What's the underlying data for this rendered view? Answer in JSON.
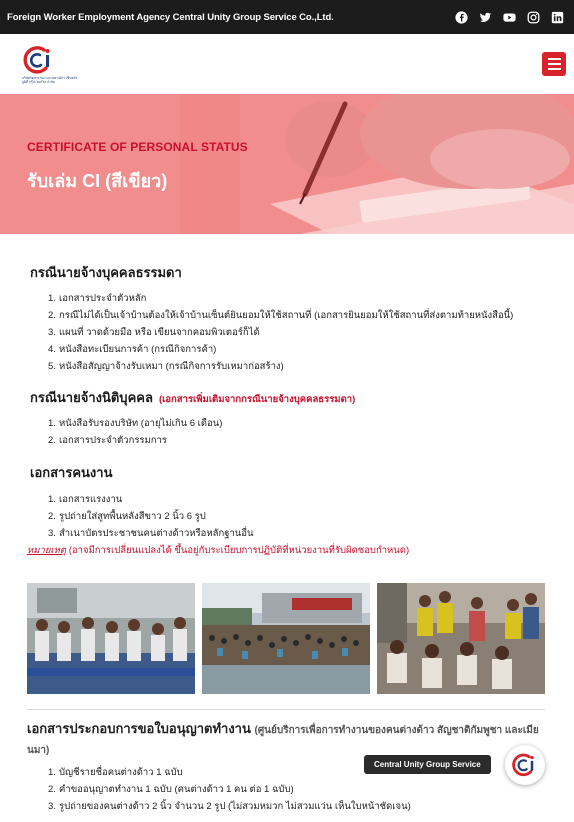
{
  "topbar": {
    "brand": "Foreign Worker Employment Agency Central Unity Group Service Co.,Ltd.",
    "social": [
      "facebook-icon",
      "twitter-icon",
      "youtube-icon",
      "instagram-icon",
      "linkedin-icon"
    ]
  },
  "header": {
    "logo_caption": "บริษัทจัดหางานแรงงานต่างด้าว เซ็นทรัล ยูนิตี้ กรุ๊ป เซอร์วิส จำกัด",
    "menu_icon": "hamburger-icon"
  },
  "hero": {
    "subtitle": "CERTIFICATE OF PERSONAL STATUS",
    "title": "รับเล่ม CI (สีเขียว)"
  },
  "section1": {
    "title": "กรณีนายจ้างบุคคลธรรมดา",
    "items": [
      {
        "n": "1.",
        "text": "เอกสารประจำตัวหลัก"
      },
      {
        "n": "2.",
        "text": "กรณีไม่ได้เป็นเจ้าบ้านต้องให้เจ้าบ้านเซ็นต์ยินยอมให้ใช้สถานที่ (เอกสารยินยอมให้ใช้สถานที่ส่งตามท้ายหนังสือนี้)"
      },
      {
        "n": "3.",
        "text": "แผนที่ วาดด้วยมือ หรือ เขียนจากคอมพิวเตอร์ก็ได้"
      },
      {
        "n": "4.",
        "text": "หนังสือทะเบียนการค้า (กรณีกิจการค้า)"
      },
      {
        "n": "5.",
        "text": "หนังสือสัญญาจ้างรับเหมา (กรณีกิจการรับเหมาก่อสร้าง)"
      }
    ]
  },
  "section2": {
    "title": "กรณีนายจ้างนิติบุคคล",
    "note": "(เอกสารเพิ่มเติมจากกรณีนายจ้างบุคคลธรรมดา)",
    "items": [
      {
        "n": "1.",
        "text": "หนังสือรับรองบริษัท (อายุไม่เกิน 6 เดือน)"
      },
      {
        "n": "2.",
        "text": "เอกสารประจำตัวกรรมการ"
      }
    ]
  },
  "section3": {
    "title": "เอกสารคนงาน",
    "items": [
      {
        "n": "1.",
        "text": "เอกสารแรงงาน"
      },
      {
        "n": "2.",
        "text": "รูปถ่ายใส่สูทพื้นหลังสีขาว 2 นิ้ว 6 รูป"
      },
      {
        "n": "3.",
        "text": "สำเนาบัตรประชาชนคนต่างด้าวหรือหลักฐานอื่น"
      }
    ],
    "remark_label": "หมายเหตุ",
    "remark_text": " (อาจมีการเปลี่ยนแปลงได้ ขึ้นอยู่กับระเบียบการปฏิบัติที่หน่วยงานที่รับผิดชอบกำหนด)"
  },
  "section4": {
    "title": "เอกสารประกอบการขอใบอนุญาตทำงาน",
    "subtitle": "(ศูนย์บริการเพื่อการทำงานของคนต่างด้าว สัญชาติกัมพูชา และเมียนมา)",
    "items": [
      {
        "n": "1.",
        "text": "บัญชีรายชื่อคนต่างด้าว 1 ฉบับ"
      },
      {
        "n": "2.",
        "text": "คำขออนุญาตทำงาน 1 ฉบับ (คนต่างด้าว 1 คน ต่อ 1 ฉบับ)"
      },
      {
        "n": "3.",
        "text": "รูปถ่ายของคนต่างด้าว 2 นิ้ว จำนวน 2 รูป (ไม่สวมหมวก ไม่สวมแว่น เห็นใบหน้าชัดเจน)"
      }
    ]
  },
  "chat": {
    "label": "Central Unity Group Service"
  },
  "colors": {
    "accent": "#c8102e",
    "topbar": "#1c1c1c",
    "menu": "#d8232a",
    "hero": "#f08181"
  }
}
